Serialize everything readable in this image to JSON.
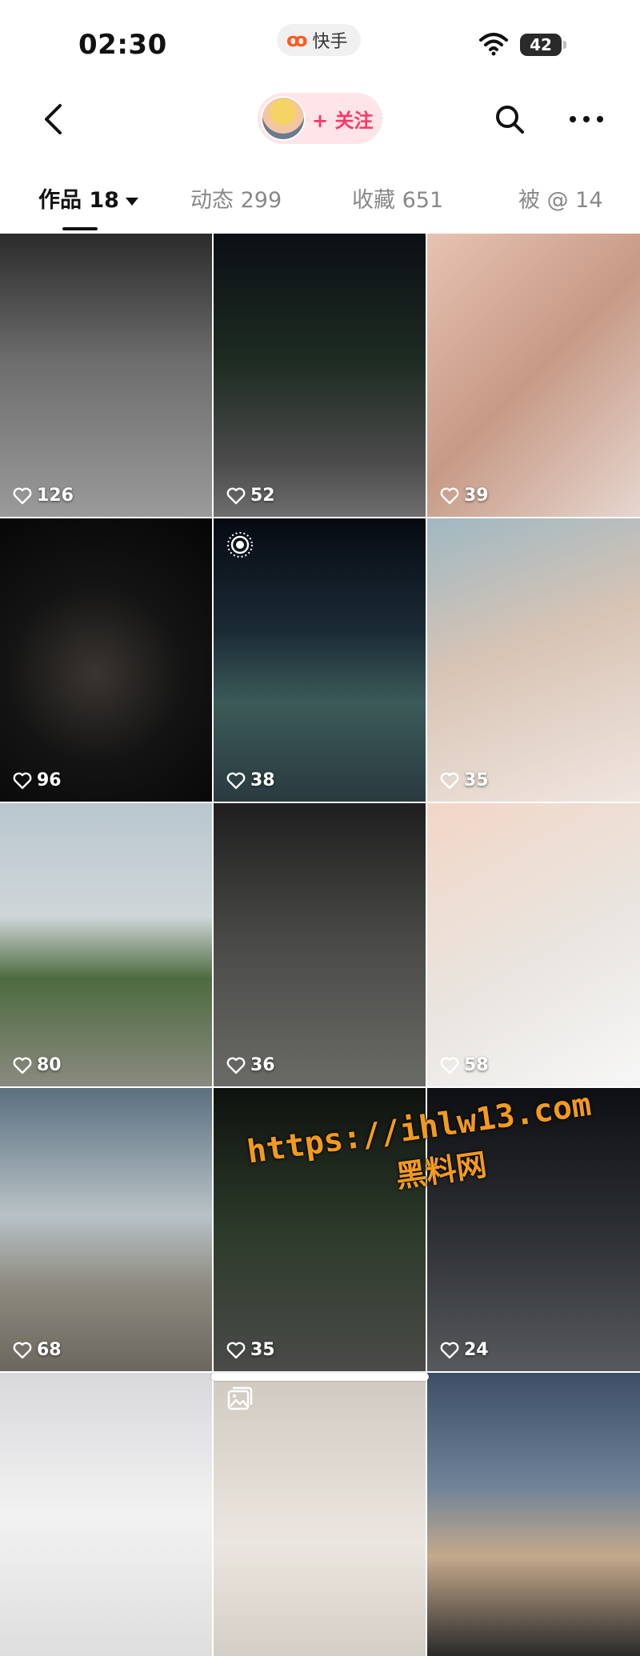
{
  "status_bar": {
    "time": "02:30",
    "app_name": "快手",
    "battery": "42",
    "icons": [
      "wifi-icon",
      "battery-icon"
    ]
  },
  "header": {
    "back_icon": "chevron-left-icon",
    "follow_label": "+ 关注",
    "search_icon": "search-icon",
    "more_icon": "more-icon"
  },
  "tabs": [
    {
      "label": "作品 18",
      "active": true
    },
    {
      "label": "动态 299",
      "active": false
    },
    {
      "label": "收藏 651",
      "active": false
    },
    {
      "label": "被 @ 14",
      "active": false
    }
  ],
  "grid": [
    {
      "likes": "126"
    },
    {
      "likes": "52"
    },
    {
      "likes": "39"
    },
    {
      "likes": "96"
    },
    {
      "likes": "38",
      "badge": "live-photo-icon"
    },
    {
      "likes": "35"
    },
    {
      "likes": "80"
    },
    {
      "likes": "36"
    },
    {
      "likes": "58"
    },
    {
      "likes": "68"
    },
    {
      "likes": "35"
    },
    {
      "likes": "24"
    },
    {
      "likes": ""
    },
    {
      "likes": "",
      "badge": "gallery-icon"
    },
    {
      "likes": ""
    }
  ],
  "watermark": {
    "url": "https://ihlw13.com",
    "name": "黑料网"
  },
  "colors": {
    "accent": "#fe3666",
    "follow_bg": "#ffe4e8",
    "watermark": "#f39a1e"
  }
}
